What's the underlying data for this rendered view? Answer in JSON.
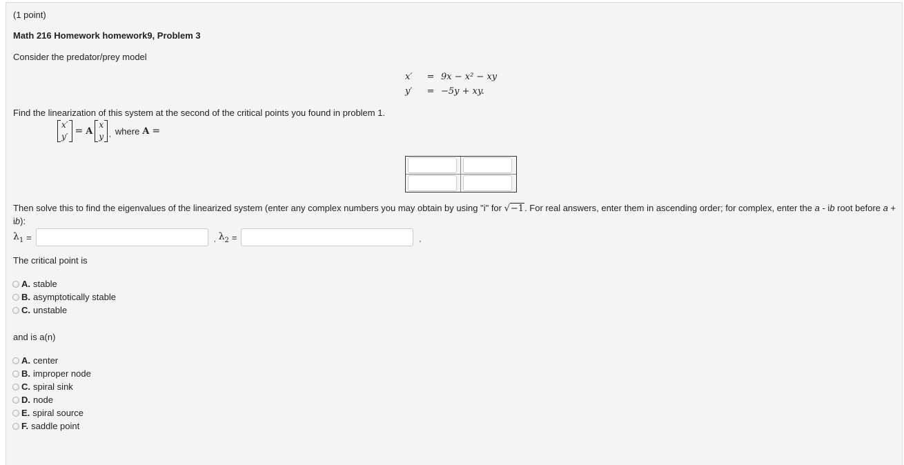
{
  "problem": {
    "points": "(1 point)",
    "title": "Math 216 Homework homework9, Problem 3",
    "intro": "Consider the predator/prey model",
    "equations": [
      {
        "lhs": "x′",
        "eq": "=",
        "rhs": "9x − x² − xy"
      },
      {
        "lhs": "y′",
        "eq": "=",
        "rhs": "−5y + xy."
      }
    ],
    "find_text": "Find the linearization of this system at the second of the critical points you found in problem 1.",
    "linearization": {
      "lhs_vector": [
        "x′",
        "y′"
      ],
      "equals": "=",
      "matrix_symbol": "A",
      "rhs_vector": [
        "x",
        "y"
      ],
      "comma": ",",
      "where_text": "where",
      "where_symbol": "A",
      "where_equals": "="
    },
    "matrix_inputs": [
      {
        "value": ""
      },
      {
        "value": ""
      },
      {
        "value": ""
      },
      {
        "value": ""
      }
    ],
    "eigen_text_1": "Then solve this to find the eigenvalues of the linearized system (enter any complex numbers you may obtain by using \"i\" for ",
    "sqrt_content": "−1",
    "eigen_text_2": ". For real answers, enter them in ascending order; for complex, enter the ",
    "eigen_a1": "a",
    "eigen_minus": " - i",
    "eigen_b1": "b",
    "eigen_root_before": " root before ",
    "eigen_a2": "a",
    "eigen_plus": " + i",
    "eigen_b2": "b",
    "eigen_end": "):",
    "lambda1_label": "λ",
    "lambda1_sub": "1",
    "lambda2_label": "λ",
    "lambda2_sub": "2",
    "equals": "=",
    "comma": ",",
    "lambda1_value": "",
    "lambda2_value": "",
    "critical_text": "The critical point is",
    "stability_options": [
      {
        "letter": "A.",
        "label": "stable"
      },
      {
        "letter": "B.",
        "label": "asymptotically stable"
      },
      {
        "letter": "C.",
        "label": "unstable"
      }
    ],
    "and_is_text": "and is a(n)",
    "type_options": [
      {
        "letter": "A.",
        "label": "center"
      },
      {
        "letter": "B.",
        "label": "improper node"
      },
      {
        "letter": "C.",
        "label": "spiral sink"
      },
      {
        "letter": "D.",
        "label": "node"
      },
      {
        "letter": "E.",
        "label": "spiral source"
      },
      {
        "letter": "F.",
        "label": "saddle point"
      }
    ]
  }
}
